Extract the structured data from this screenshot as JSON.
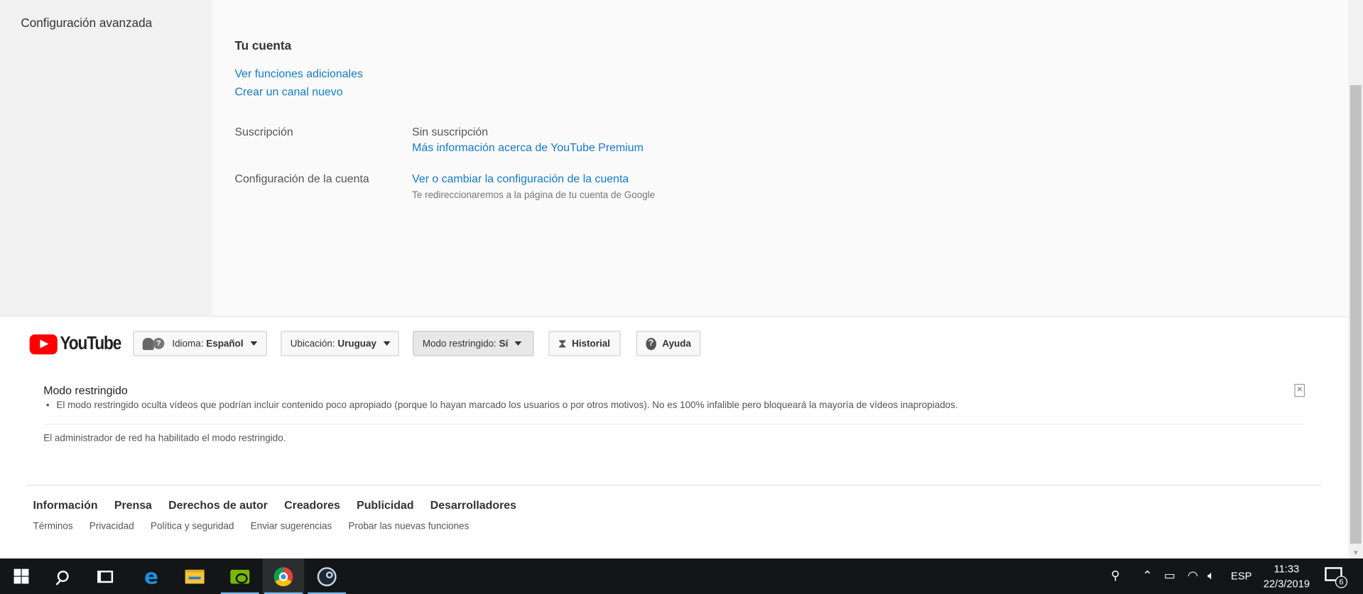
{
  "left_nav": {
    "item": "Configuración avanzada"
  },
  "account": {
    "title": "Tu cuenta",
    "link_more_features": "Ver funciones adicionales",
    "link_new_channel": "Crear un canal nuevo",
    "subscription": {
      "label": "Suscripción",
      "value": "Sin suscripción",
      "link": "Más información acerca de YouTube Premium"
    },
    "settings": {
      "label": "Configuración de la cuenta",
      "link": "Ver o cambiar la configuración de la cuenta",
      "note": "Te redireccionaremos a la página de tu cuenta de Google"
    }
  },
  "footer": {
    "logo_text": "YouTube",
    "language": {
      "prefix": "Idioma:",
      "value": "Español"
    },
    "location": {
      "prefix": "Ubicación:",
      "value": "Uruguay"
    },
    "restricted": {
      "prefix": "Modo restringido:",
      "value": "Sí"
    },
    "history_label": "Historial",
    "help_label": "Ayuda",
    "restricted_panel": {
      "title": "Modo restringido",
      "bullet": "El modo restringido oculta vídeos que podrían incluir contenido poco apropiado (porque lo hayan marcado los usuarios o por otros motivos). No es 100% infalible pero bloqueará la mayoría de vídeos inapropiados.",
      "admin_note": "El administrador de red ha habilitado el modo restringido."
    },
    "primary_links": [
      "Información",
      "Prensa",
      "Derechos de autor",
      "Creadores",
      "Publicidad",
      "Desarrolladores"
    ],
    "secondary_links": [
      "Términos",
      "Privacidad",
      "Política y seguridad",
      "Enviar sugerencias",
      "Probar las nuevas funciones"
    ]
  },
  "taskbar": {
    "apps": [
      "windows-start-icon",
      "search-icon",
      "task-view-icon",
      "edge-icon",
      "file-explorer-icon",
      "nvidia-icon",
      "chrome-icon",
      "steam-icon"
    ],
    "language": "ESP",
    "time": "11:33",
    "date": "22/3/2019",
    "notification_count": "6"
  },
  "colors": {
    "link": "#167ac6",
    "youtube_red": "#ff0000",
    "taskbar": "#141516"
  }
}
